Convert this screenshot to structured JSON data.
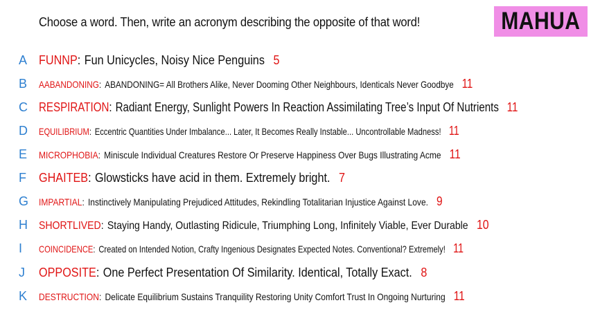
{
  "prompt": "Choose a word. Then, write an acronym describing the opposite of that word!",
  "badge": "MAHUA",
  "colors": {
    "letter": "#2d7fd0",
    "word": "#e01414",
    "badge_bg": "#f08ee6"
  },
  "rows": [
    {
      "letter": "A",
      "word": "FUNNP",
      "acronym": "Fun Unicycles, Noisy Nice Penguins",
      "count": "5"
    },
    {
      "letter": "B",
      "word": "AABANDONING",
      "acronym": "ABANDONING= All Brothers Alike, Never Dooming Other Neighbours, Identicals Never Goodbye",
      "count": "11"
    },
    {
      "letter": "C",
      "word": "RESPIRATION",
      "acronym": "Radiant Energy, Sunlight Powers In Reaction Assimilating Tree’s Input Of Nutrients",
      "count": "11"
    },
    {
      "letter": "D",
      "word": "EQUILIBRIUM",
      "acronym": "Eccentric Quantities Under Imbalance... Later, It Becomes Really Instable... Uncontrollable Madness!",
      "count": "11"
    },
    {
      "letter": "E",
      "word": "MICROPHOBIA",
      "acronym": "Miniscule Individual Creatures Restore Or Preserve Happiness Over Bugs Illustrating Acme",
      "count": "11"
    },
    {
      "letter": "F",
      "word": "GHAITEB",
      "acronym": "Glowsticks have acid in them. Extremely bright.",
      "count": "7"
    },
    {
      "letter": "G",
      "word": "IMPARTIAL",
      "acronym": "Instinctively Manipulating Prejudiced Attitudes, Rekindling Totalitarian Injustice Against Love.",
      "count": "9"
    },
    {
      "letter": "H",
      "word": "SHORTLIVED",
      "acronym": "Staying Handy, Outlasting Ridicule, Triumphing Long, Infinitely Viable, Ever Durable",
      "count": "10"
    },
    {
      "letter": "I",
      "word": "COINCIDENCE",
      "acronym": "Created on Intended Notion, Crafty Ingenious Designates Expected Notes. Conventional? Extremely!",
      "count": "11"
    },
    {
      "letter": "J",
      "word": "OPPOSITE",
      "acronym": "One Perfect Presentation Of Similarity. Identical, Totally Exact.",
      "count": "8"
    },
    {
      "letter": "K",
      "word": "DESTRUCTION",
      "acronym": "Delicate Equilibrium Sustains Tranquility Restoring Unity Comfort Trust In Ongoing Nurturing",
      "count": "11"
    }
  ]
}
